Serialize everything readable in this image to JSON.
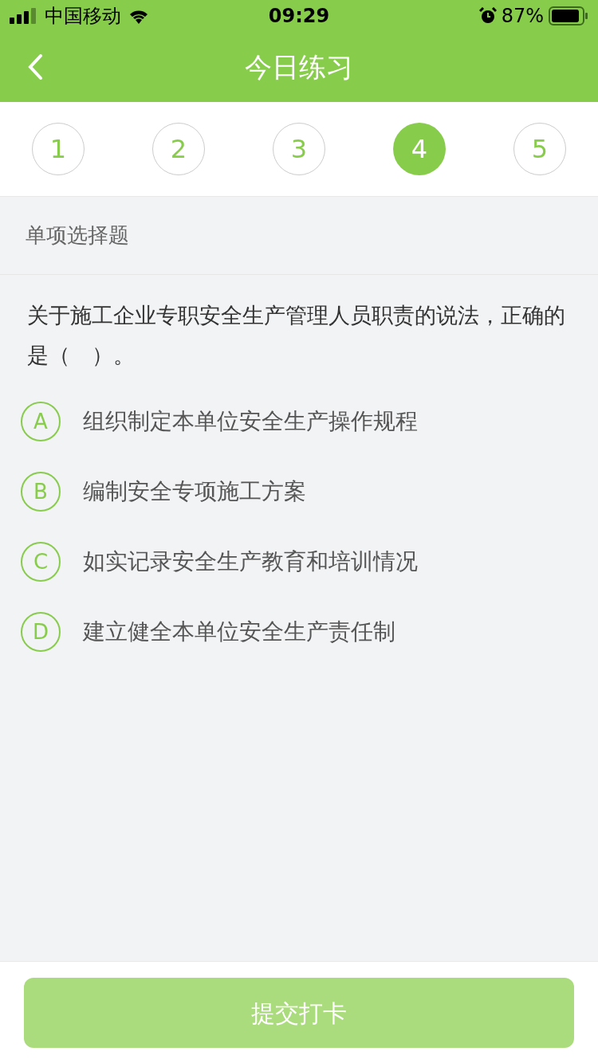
{
  "status_bar": {
    "carrier": "中国移动",
    "time": "09:29",
    "battery": "87%"
  },
  "nav": {
    "title": "今日练习"
  },
  "question_tabs": [
    {
      "label": "1",
      "selected": false
    },
    {
      "label": "2",
      "selected": false
    },
    {
      "label": "3",
      "selected": false
    },
    {
      "label": "4",
      "selected": true
    },
    {
      "label": "5",
      "selected": false
    }
  ],
  "section": {
    "title": "单项选择题"
  },
  "question": {
    "text": "关于施工企业专职安全生产管理人员职责的说法，正确的是（　）。",
    "options": [
      {
        "letter": "A",
        "text": "组织制定本单位安全生产操作规程",
        "selected": false
      },
      {
        "letter": "B",
        "text": "编制安全专项施工方案",
        "selected": false
      },
      {
        "letter": "C",
        "text": "如实记录安全生产教育和培训情况",
        "selected": false
      },
      {
        "letter": "D",
        "text": "建立健全本单位安全生产责任制",
        "selected": false
      }
    ]
  },
  "submit": {
    "label": "提交打卡",
    "disabled": true
  }
}
